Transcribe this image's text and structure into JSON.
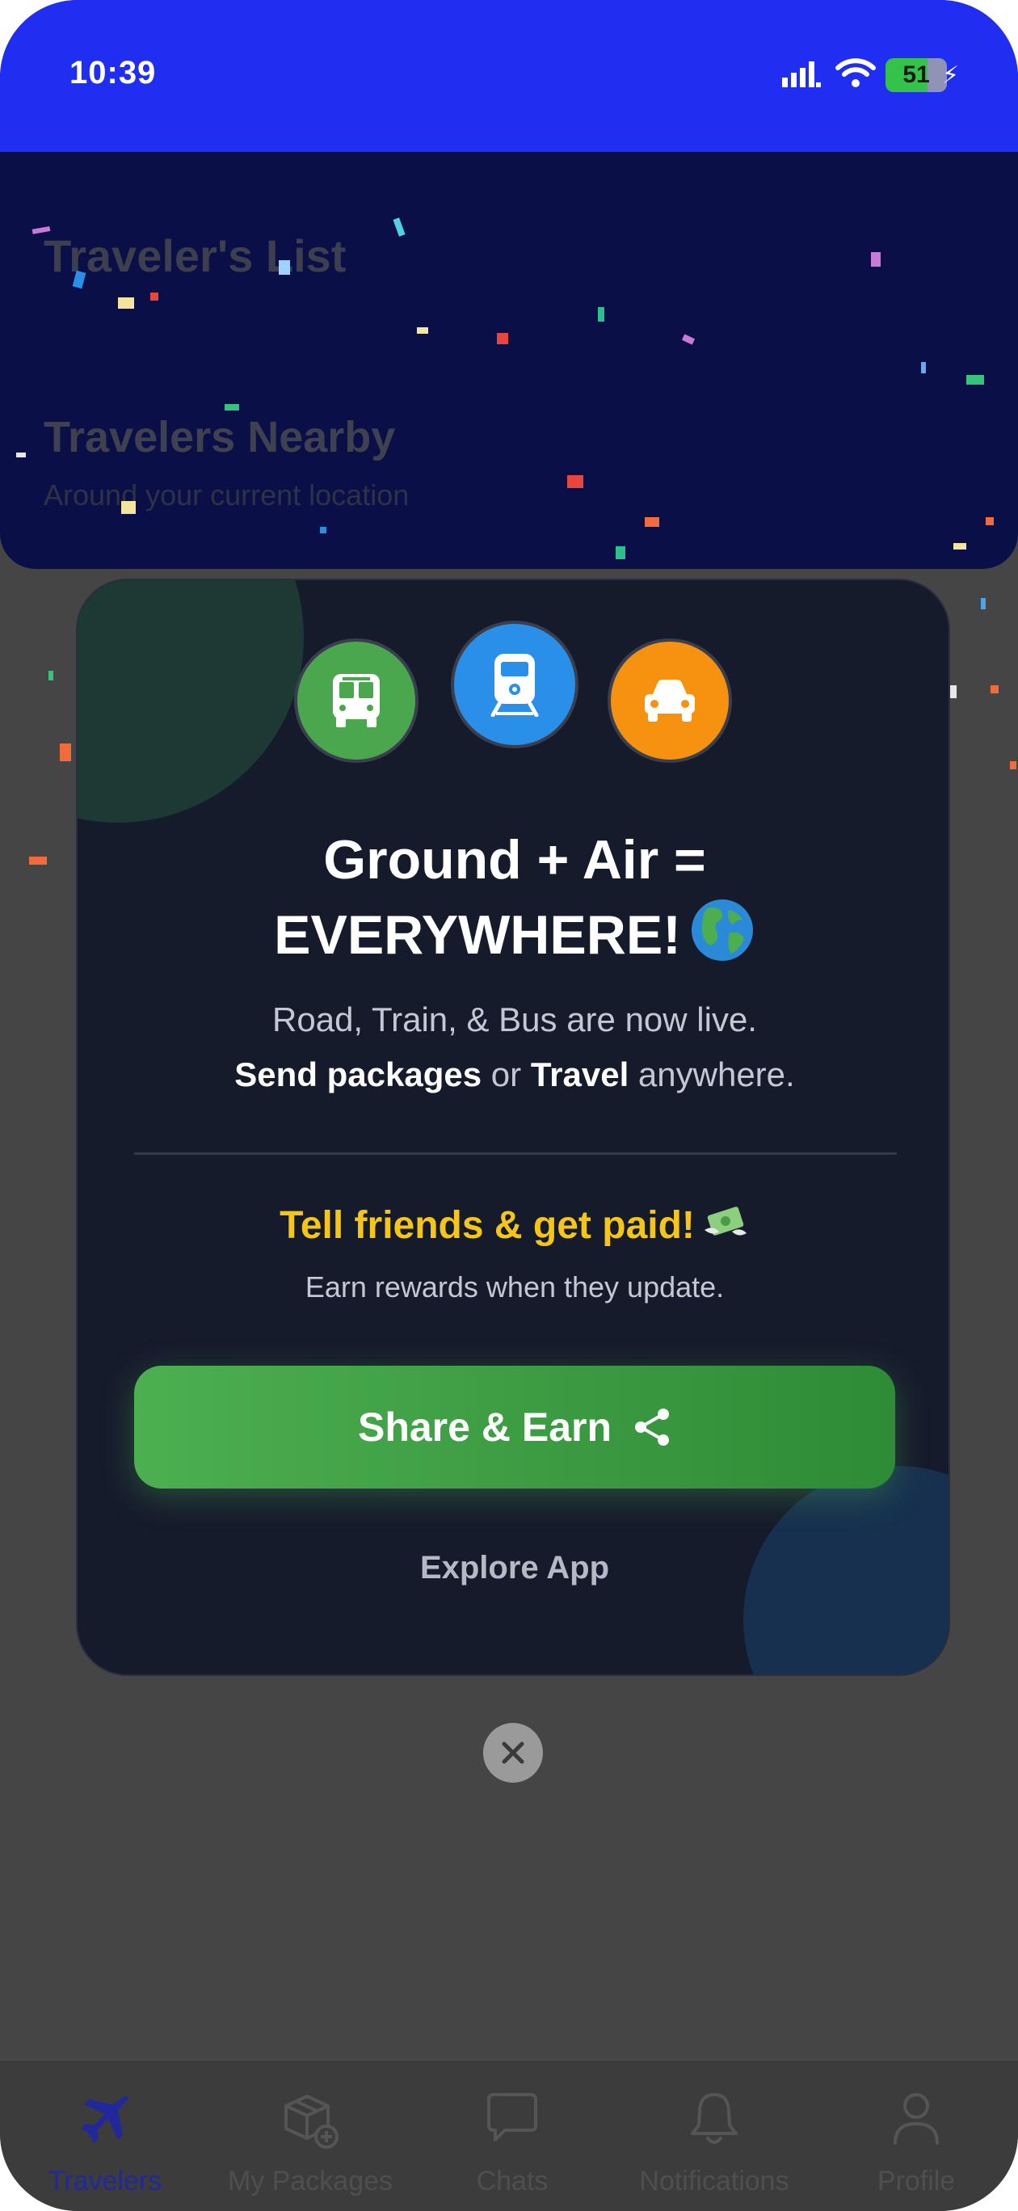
{
  "status_bar": {
    "time": "10:39",
    "battery": "51"
  },
  "header": {
    "title": "Traveler's List",
    "section_title": "Travelers Nearby",
    "section_subtitle": "Around your current location"
  },
  "modal": {
    "mode_icons": [
      "bus-icon",
      "train-icon",
      "car-icon"
    ],
    "headline_line1": "Ground + Air =",
    "headline_line2": "EVERYWHERE!",
    "desc_line1": "Road, Train, & Bus are now live.",
    "desc_send": "Send packages",
    "desc_or": "or",
    "desc_travel": "Travel",
    "desc_anywhere": "anywhere.",
    "promo_title": "Tell friends & get paid!",
    "promo_subtitle": "Earn rewards when they update.",
    "share_button": "Share & Earn",
    "explore_link": "Explore App"
  },
  "bottom_nav": [
    {
      "label": "Travelers",
      "icon": "airplane-icon",
      "active": true
    },
    {
      "label": "My Packages",
      "icon": "package-icon",
      "active": false
    },
    {
      "label": "Chats",
      "icon": "chat-icon",
      "active": false
    },
    {
      "label": "Notifications",
      "icon": "bell-icon",
      "active": false
    },
    {
      "label": "Profile",
      "icon": "user-icon",
      "active": false
    }
  ],
  "colors": {
    "status_bar": "#1f2ef0",
    "header": "#0b0f47",
    "card": "#161b2c",
    "accent_green": "#4caf50",
    "promo_yellow": "#f5c518",
    "active_nav": "#21289a"
  }
}
